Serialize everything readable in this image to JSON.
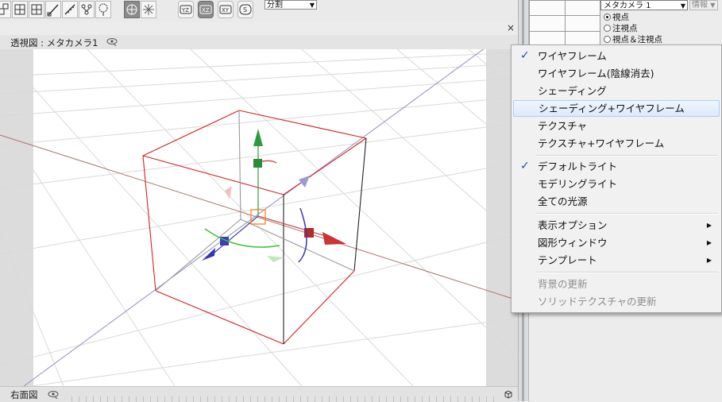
{
  "toolbar": {
    "split_select": "分割"
  },
  "view_top": {
    "title": "透視図 : メタカメラ1",
    "close": "×"
  },
  "view_bottom": {
    "title": "右面図"
  },
  "right_panel": {
    "camera_select": "メタカメラ 1",
    "info_label": "情報",
    "radios": [
      {
        "label": "視点",
        "checked": true
      },
      {
        "label": "注視点",
        "checked": false
      },
      {
        "label": "視点＆注視点",
        "checked": false
      }
    ]
  },
  "menu": {
    "items": [
      {
        "label": "ワイヤフレーム",
        "checked": true
      },
      {
        "label": "ワイヤフレーム(陰線消去)"
      },
      {
        "label": "シェーディング"
      },
      {
        "label": "シェーディング+ワイヤフレーム",
        "highlighted": true
      },
      {
        "label": "テクスチャ"
      },
      {
        "label": "テクスチャ+ワイヤフレーム"
      },
      {
        "label": "デフォルトライト",
        "checked": true
      },
      {
        "label": "モデリングライト"
      },
      {
        "label": "全ての光源"
      },
      {
        "label": "表示オプション",
        "submenu": true
      },
      {
        "label": "図形ウィンドウ",
        "submenu": true
      },
      {
        "label": "テンプレート",
        "submenu": true
      },
      {
        "label": "背景の更新",
        "disabled": true
      },
      {
        "label": "ソリッドテクスチャの更新",
        "disabled": true
      }
    ]
  },
  "icons": {
    "menu_check": "checkmark-icon",
    "submenu_arrow": "chevron-right-icon"
  }
}
